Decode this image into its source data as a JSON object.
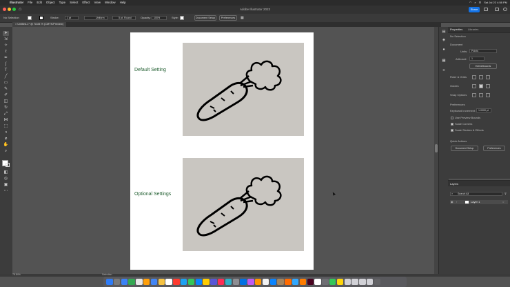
{
  "menubar": {
    "apple": "",
    "items": [
      "Illustrator",
      "File",
      "Edit",
      "Object",
      "Type",
      "Select",
      "Effect",
      "View",
      "Window",
      "Help"
    ],
    "status": [
      "Sat Jul 22 4:58 PM"
    ]
  },
  "window": {
    "title": "Adobe Illustrator 2023",
    "share_label": "Share",
    "home_icon": "home-icon"
  },
  "controlbar": {
    "selection_label": "No Selection",
    "stroke_label": "Stroke:",
    "stroke_value": "1 pt",
    "brush_value": "Uniform",
    "profile_value": "5 pt. Round",
    "opacity_label": "Opacity:",
    "opacity_value": "100%",
    "style_label": "Style:",
    "document_setup": "Document Setup",
    "preferences": "Preferences"
  },
  "document": {
    "tab_label": "Untitled-1* @ 78.84 % (CMYK/Preview)"
  },
  "artboard": {
    "label_top": "Default Setting",
    "label_bottom": "Optional  Settings",
    "text_color": "#1f5d2f"
  },
  "properties": {
    "tab_properties": "Properties",
    "tab_libraries": "Libraries",
    "no_selection": "No Selection",
    "document_heading": "Document",
    "units_label": "Units:",
    "units_value": "Points",
    "artboard_label": "Artboard:",
    "artboard_value": "1",
    "edit_artboards": "Edit Artboards",
    "ruler_grids": "Ruler & Grids",
    "guides": "Guides",
    "snap_options": "Snap Options",
    "preferences_heading": "Preferences",
    "keyboard_increment_label": "Keyboard Increment:",
    "keyboard_increment_value": "1.0000 pt",
    "use_preview_bounds": "Use Preview Bounds",
    "scale_corners": "Scale Corners",
    "scale_strokes": "Scale Strokes & Effects",
    "quick_actions": "Quick Actions",
    "quick_document_setup": "Document Setup",
    "quick_preferences": "Preferences"
  },
  "layers": {
    "title": "Layers",
    "search_placeholder": "Search All",
    "layer_name": "Layer 1"
  },
  "statusbar": {
    "zoom": "78.84%",
    "tool": "Selection"
  },
  "dock_colors": [
    "#2f7cf6",
    "#7a7a7a",
    "#3b82f6",
    "#34a853",
    "#e7e7e7",
    "#ff9f0a",
    "#4285f4",
    "#f5c242",
    "#ffffff",
    "#ff3b30",
    "#1da1f2",
    "#34c759",
    "#0a84ff",
    "#ffcc00",
    "#5856d6",
    "#ff2d55",
    "#30b0c7",
    "#8e8e93",
    "#0071e3",
    "#bf5af2",
    "#ff9500",
    "#f2f2f2",
    "#0a84ff",
    "#a2845e",
    "#ff6b00",
    "#31a8ff",
    "#ff7c00",
    "#49021f",
    "#ffffff",
    "#6e6e73",
    "#34c759",
    "#ffd60a",
    "#d1d1d6",
    "#d1d1d6",
    "#d1d1d6",
    "#d1d1d6",
    "#636366"
  ]
}
